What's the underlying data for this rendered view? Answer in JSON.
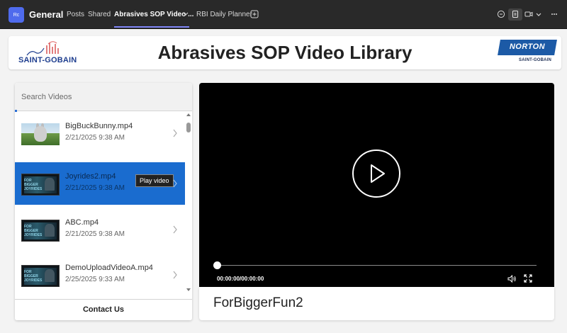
{
  "teams_bar": {
    "team_initials": "Rc",
    "channel": "General",
    "tabs": [
      {
        "label": "Posts"
      },
      {
        "label": "Shared"
      },
      {
        "label": "Abrasives SOP Video ..."
      },
      {
        "label": "RBI Daily Planner"
      }
    ],
    "icons": [
      "chat-icon",
      "meeting-notes-icon",
      "video-call-icon",
      "chevron-down-icon"
    ]
  },
  "header": {
    "left_logo_text": "SAINT-GOBAIN",
    "title": "Abrasives SOP Video Library",
    "right_logo_text": "NORTON",
    "right_logo_sub": "SAINT-GOBAIN"
  },
  "search": {
    "placeholder": "Search Videos"
  },
  "videos": [
    {
      "name": "BigBuckBunny.mp4",
      "date": "2/21/2025 9:38 AM",
      "thumb": "bunny"
    },
    {
      "name": "Joyrides2.mp4",
      "date": "2/21/2025 9:38 AM",
      "thumb": "fun",
      "selected": true
    },
    {
      "name": "ABC.mp4",
      "date": "2/21/2025 9:38 AM",
      "thumb": "fun"
    },
    {
      "name": "DemoUploadVideoA.mp4",
      "date": "2/25/2025 9:33 AM",
      "thumb": "fun"
    }
  ],
  "thumb_text": "FOR BIGGER JOYRIDES",
  "tooltip": "Play video",
  "contact_label": "Contact Us",
  "player": {
    "time": "00:00:00/00:00:00",
    "progress": 0
  },
  "caption": "ForBiggerFun2",
  "colors": {
    "accent": "#1a6ccf",
    "teams_bar": "#292929",
    "tab_underline": "#7f85f5"
  }
}
